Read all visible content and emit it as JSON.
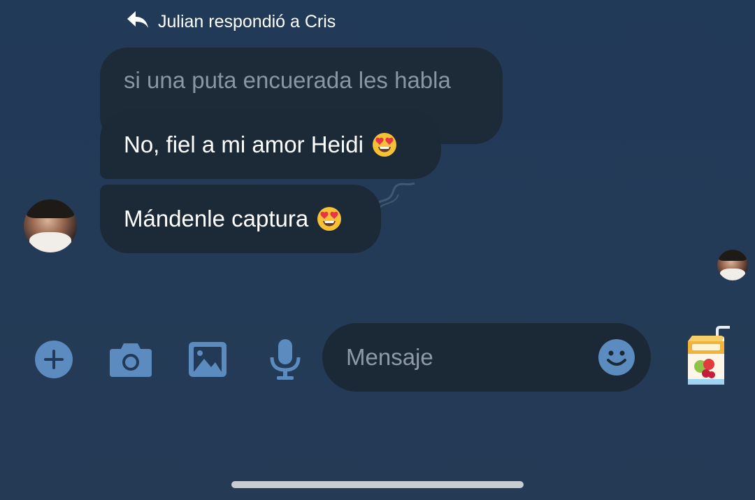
{
  "reply_header": {
    "text": "Julian respondió a Cris",
    "icon": "reply-arrow-icon"
  },
  "messages": {
    "quoted": "si una puta encuerada les habla",
    "first": "No, fiel a mi amor Heidi",
    "second": "Mándenle captura",
    "emoji": "heart-eyes-emoji"
  },
  "toolbar": {
    "icons": [
      "plus-icon",
      "camera-icon",
      "gallery-icon",
      "microphone-icon",
      "smiley-icon",
      "juice-box-sticker-icon"
    ],
    "composer_placeholder": "Mensaje"
  },
  "colors": {
    "background": "#233a56",
    "bubble": "#1c2a38",
    "icon_blue": "#5b8bbf",
    "quoted_text": "#8a96a3"
  }
}
